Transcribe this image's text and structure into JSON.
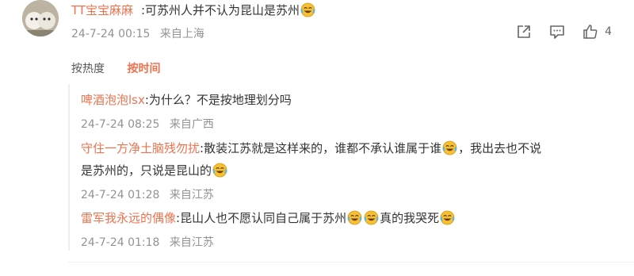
{
  "comment": {
    "username": "TT宝宝麻麻",
    "text": ":可苏州人并不认为昆山是苏州",
    "emoji": "laugh-cry-emoji",
    "date": "24-7-24 00:15",
    "location": "来自上海",
    "like_count": "4"
  },
  "sort_tabs": {
    "heat_label": "按热度",
    "time_label": "按时间"
  },
  "replies": [
    {
      "username": "啤酒泡泡lsx",
      "text": ":为什么？不是按地理划分吗",
      "date": "24-7-24 08:25",
      "location": "来自广西"
    },
    {
      "username": "守住一方净土脑残勿扰",
      "text_part1": ":散装江苏就是这样来的，谁都不承认谁属于谁",
      "text_part2": "，我出去也不说",
      "text_line2": "是苏州的，只说是昆山的",
      "date": "24-7-24 01:28",
      "location": "来自江苏"
    },
    {
      "username": "雷军我永远的偶像",
      "text_part1": ":昆山人也不愿认同自己属于苏州",
      "text_part2": "真的我哭死",
      "date": "24-7-24 01:18",
      "location": "来自江苏"
    }
  ],
  "colors": {
    "accent": "#eb7350",
    "meta_gray": "#939393",
    "emoji_yellow": "#f6c033"
  }
}
